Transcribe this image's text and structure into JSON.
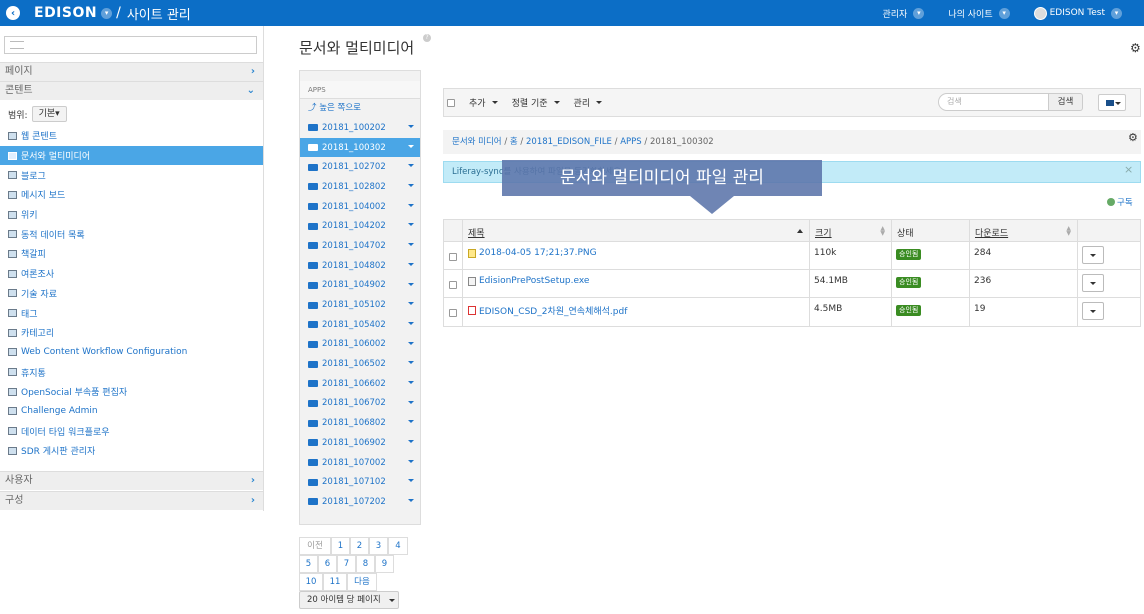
{
  "topbar": {
    "brand": "EDISON",
    "separator": "/",
    "subtitle": "사이트 관리",
    "admin_label": "관리자",
    "my_sites_label": "나의 사이트",
    "user_label": "EDISON Test",
    "bg_color": "#0c6ec6"
  },
  "sidebar": {
    "sections": {
      "pages": "페이지",
      "content": "콘텐트",
      "users": "사용자",
      "config": "구성"
    },
    "scope_label": "범위:",
    "scope_value": "기본",
    "items": [
      {
        "label": "웹 콘텐트",
        "icon": "web-content-icon"
      },
      {
        "label": "문서와 멀티미디어",
        "icon": "documents-icon"
      },
      {
        "label": "블로그",
        "icon": "blog-icon"
      },
      {
        "label": "메시지 보드",
        "icon": "message-board-icon"
      },
      {
        "label": "위키",
        "icon": "wiki-icon"
      },
      {
        "label": "동적 데이터 목록",
        "icon": "dynamic-data-icon"
      },
      {
        "label": "책갈피",
        "icon": "bookmark-icon"
      },
      {
        "label": "여론조사",
        "icon": "poll-icon"
      },
      {
        "label": "기술 자료",
        "icon": "knowledge-base-icon"
      },
      {
        "label": "태그",
        "icon": "tag-icon"
      },
      {
        "label": "카테고리",
        "icon": "category-icon"
      },
      {
        "label": "Web Content Workflow Configuration",
        "icon": "workflow-icon"
      },
      {
        "label": "휴지통",
        "icon": "trash-icon"
      },
      {
        "label": "OpenSocial 부속품 편집자",
        "icon": "opensocial-icon"
      },
      {
        "label": "Challenge Admin",
        "icon": "challenge-icon"
      },
      {
        "label": "데이터 타입 워크플로우",
        "icon": "data-workflow-icon"
      },
      {
        "label": "SDR 게시판 관리자",
        "icon": "board-icon"
      }
    ],
    "active_index": 1,
    "active_color": "#4aa6e6"
  },
  "page": {
    "title": "문서와 멀티미디어"
  },
  "apps": {
    "header": "APPS",
    "up_label": "높은 쪽으로",
    "folders": [
      "20181_100202",
      "20181_100302",
      "20181_102702",
      "20181_102802",
      "20181_104002",
      "20181_104202",
      "20181_104702",
      "20181_104802",
      "20181_104902",
      "20181_105102",
      "20181_105402",
      "20181_106002",
      "20181_106502",
      "20181_106602",
      "20181_106702",
      "20181_106802",
      "20181_106902",
      "20181_107002",
      "20181_107102",
      "20181_107202"
    ],
    "active_index": 1
  },
  "pagination": {
    "prev": "이전",
    "next": "다음",
    "pages": [
      "1",
      "2",
      "3",
      "4",
      "5",
      "6",
      "7",
      "8",
      "9",
      "10",
      "11"
    ],
    "per_page": "20 아이템 당 페이지"
  },
  "toolbar": {
    "add": "추가",
    "sort": "정렬 기준",
    "manage": "관리",
    "search_placeholder": "검색",
    "search_button": "검색"
  },
  "breadcrumb": {
    "items": [
      "문서와 미디어",
      "홈",
      "20181_EDISON_FILE",
      "APPS"
    ],
    "current": "20181_100302"
  },
  "alert": {
    "text": "Liferay-sync를 사용하여 파일을 동기화하세요.",
    "close": "×"
  },
  "tooltip": {
    "text": "문서와 멀티미디어 파일 관리"
  },
  "subscribe_label": "구독",
  "table": {
    "headers": {
      "title": "제목",
      "size": "크기",
      "status": "상태",
      "downloads": "다운로드"
    },
    "rows": [
      {
        "name": "2018-04-05 17;21;37.PNG",
        "icon": "image-file-icon",
        "size": "110k",
        "status": "승인됨",
        "downloads": "284"
      },
      {
        "name": "EdisionPrePostSetup.exe",
        "icon": "exe-file-icon",
        "size": "54.1MB",
        "status": "승인됨",
        "downloads": "236"
      },
      {
        "name": "EDISON_CSD_2차원_연속체해석.pdf",
        "icon": "pdf-file-icon",
        "size": "4.5MB",
        "status": "승인됨",
        "downloads": "19"
      }
    ],
    "status_color": "#3a8c22"
  }
}
